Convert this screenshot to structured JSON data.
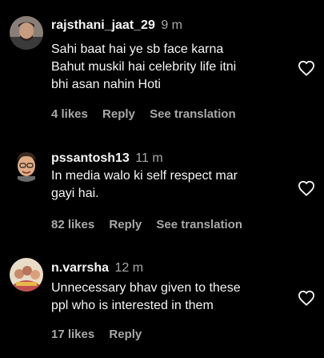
{
  "comments": [
    {
      "username": "rajsthani_jaat_29",
      "time": "9 m",
      "text_lines": [
        "Sahi baat hai ye sb face karna",
        "Bahut muskil hai celebrity life itni",
        "bhi asan nahin Hoti"
      ],
      "likes": "4 likes",
      "reply": "Reply",
      "translation": "See translation"
    },
    {
      "username": "pssantosh13",
      "time": "11 m",
      "text_lines": [
        "In media walo ki self respect mar",
        "gayi hai."
      ],
      "likes": "82 likes",
      "reply": "Reply",
      "translation": "See translation"
    },
    {
      "username": "n.varrsha",
      "time": "12 m",
      "text_lines": [
        "Unnecessary bhav given to these",
        "ppl who is interested in them"
      ],
      "likes": "17 likes",
      "reply": "Reply"
    }
  ],
  "icons": {
    "like": "heart-outline-icon"
  },
  "colors": {
    "background": "#000000",
    "primary_text": "#f5f5f5",
    "secondary_text": "#a8a8a8"
  }
}
